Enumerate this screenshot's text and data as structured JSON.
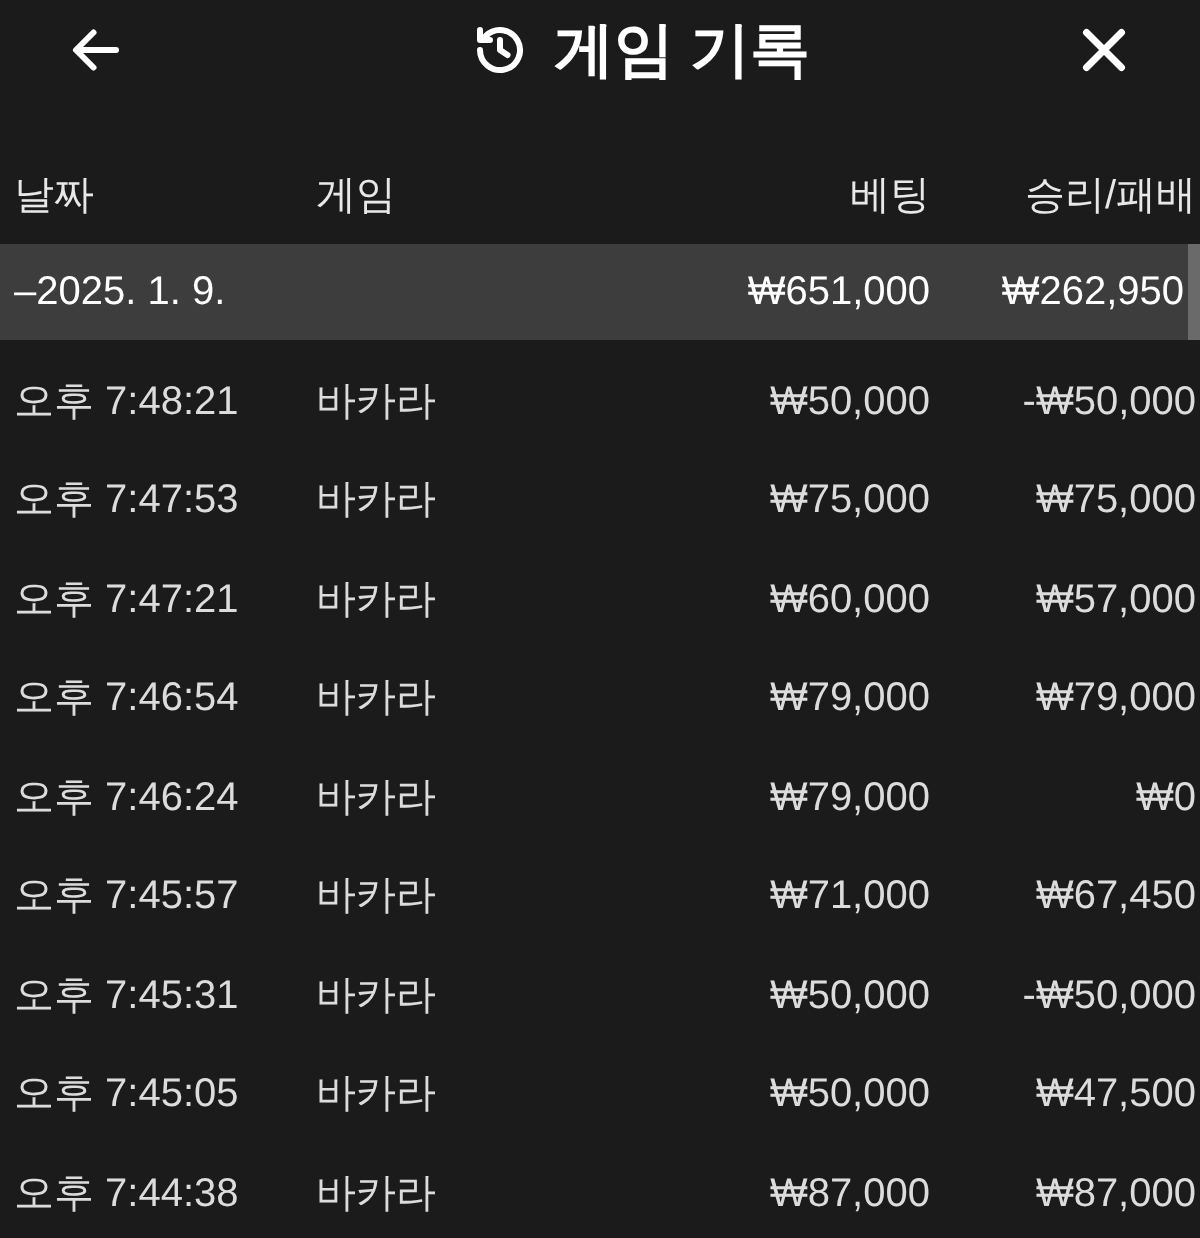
{
  "header": {
    "title": "게임 기록"
  },
  "table": {
    "columns": [
      "날짜",
      "게임",
      "베팅",
      "승리/패배"
    ],
    "group": {
      "date": "–2025. 1. 9.",
      "bet": "₩651,000",
      "result": "₩262,950",
      "selected": true
    },
    "rows": [
      {
        "time": "오후 7:48:21",
        "game": "바카라",
        "bet": "₩50,000",
        "result": "-₩50,000"
      },
      {
        "time": "오후 7:47:53",
        "game": "바카라",
        "bet": "₩75,000",
        "result": "₩75,000"
      },
      {
        "time": "오후 7:47:21",
        "game": "바카라",
        "bet": "₩60,000",
        "result": "₩57,000"
      },
      {
        "time": "오후 7:46:54",
        "game": "바카라",
        "bet": "₩79,000",
        "result": "₩79,000"
      },
      {
        "time": "오후 7:46:24",
        "game": "바카라",
        "bet": "₩79,000",
        "result": "₩0"
      },
      {
        "time": "오후 7:45:57",
        "game": "바카라",
        "bet": "₩71,000",
        "result": "₩67,450"
      },
      {
        "time": "오후 7:45:31",
        "game": "바카라",
        "bet": "₩50,000",
        "result": "-₩50,000"
      },
      {
        "time": "오후 7:45:05",
        "game": "바카라",
        "bet": "₩50,000",
        "result": "₩47,500"
      },
      {
        "time": "오후 7:44:38",
        "game": "바카라",
        "bet": "₩87,000",
        "result": "₩87,000"
      }
    ]
  }
}
